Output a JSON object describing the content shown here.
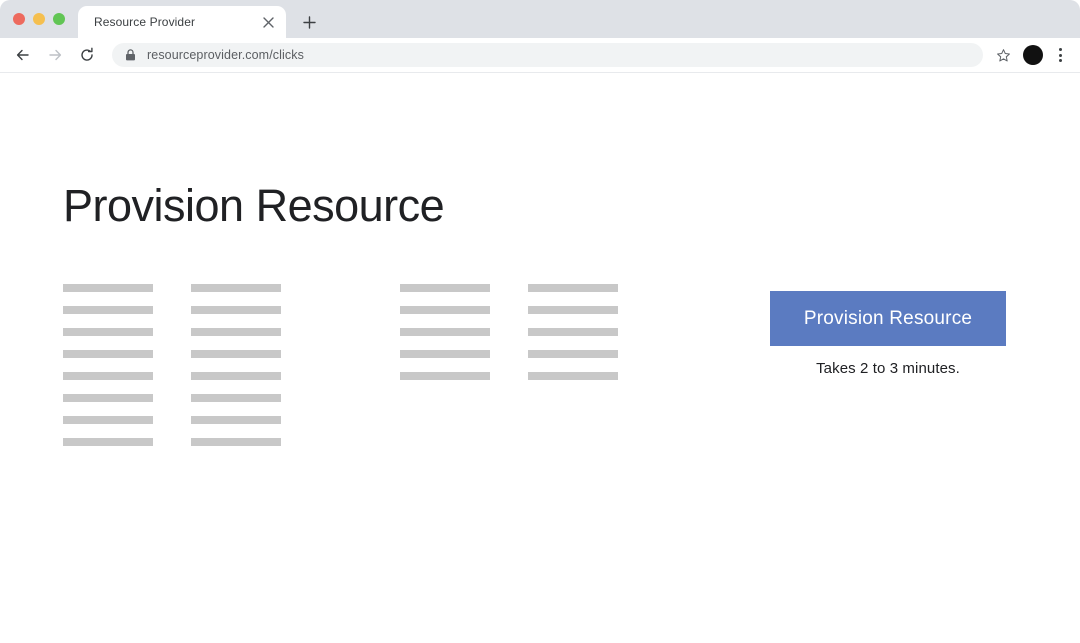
{
  "browser": {
    "traffic_lights": [
      {
        "name": "close-window-button",
        "color": "#ed6a5e"
      },
      {
        "name": "minimize-window-button",
        "color": "#f5bf4f"
      },
      {
        "name": "maximize-window-button",
        "color": "#61c554"
      }
    ],
    "tab": {
      "title": "Resource Provider",
      "close_label": "×"
    },
    "new_tab_label": "+",
    "nav": {
      "back_icon": "arrow-left-icon",
      "forward_icon": "arrow-right-icon",
      "reload_icon": "reload-icon"
    },
    "omnibox": {
      "url": "resourceprovider.com/clicks",
      "placeholder": "Search Google or type a URL",
      "lock_icon": "lock-icon"
    },
    "star_icon": "star-icon",
    "avatar": {
      "name": "profile-avatar",
      "color": "#111111"
    },
    "menu_icon": "kebab-menu-icon"
  },
  "page": {
    "title": "Provision Resource",
    "placeholder_groups": [
      {
        "id": "col1",
        "bars": 8
      },
      {
        "id": "col2",
        "bars": 8
      },
      {
        "id": "col3",
        "bars": 5
      },
      {
        "id": "col4",
        "bars": 5
      }
    ],
    "action": {
      "button_label": "Provision Resource",
      "button_color": "#5b7bc1",
      "hint": "Takes 2 to 3 minutes."
    }
  }
}
